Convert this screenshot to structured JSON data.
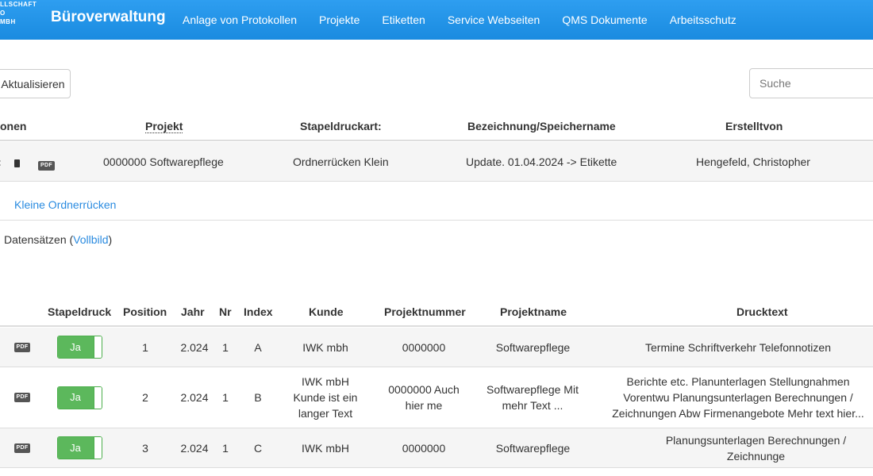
{
  "navbar": {
    "logo_lines": [
      "LLSCHAFT",
      "O",
      "MBH"
    ],
    "brand": "Büroverwaltung",
    "links": [
      "Anlage von Protokollen",
      "Projekte",
      "Etiketten",
      "Service Webseiten",
      "QMS Dokumente",
      "Arbeitsschutz"
    ]
  },
  "toolbar": {
    "refresh_label": "Aktualisieren",
    "search_placeholder": "Suche"
  },
  "top_table": {
    "headers": [
      "onen",
      "Projekt",
      "Stapeldruckart:",
      "Bezeichnung/Speichername",
      "Erstelltvon"
    ],
    "row": {
      "pdf": "PDF",
      "projekt": "0000000 Softwarepflege",
      "stapeldruckart": "Ordnerrücken Klein",
      "bezeichnung": "Update. 01.04.2024 -> Etikette",
      "erstelltvon": "Hengefeld, Christopher"
    },
    "detail_link": "Kleine Ordnerrücken"
  },
  "record_count": {
    "text": "Datensätzen (",
    "link": "Vollbild",
    "close": ")"
  },
  "bottom_table": {
    "headers": [
      "Stapeldruck",
      "Position",
      "Jahr",
      "Nr",
      "Index",
      "Kunde",
      "Projektnummer",
      "Projektname",
      "Drucktext"
    ],
    "rows": [
      {
        "pdf": "PDF",
        "toggle": "Ja",
        "position": "1",
        "jahr": "2.024",
        "nr": "1",
        "index": "A",
        "kunde": "IWK mbh",
        "projektnummer": "0000000",
        "projektname": "Softwarepflege",
        "drucktext": "Termine Schriftverkehr Telefonnotizen"
      },
      {
        "pdf": "PDF",
        "toggle": "Ja",
        "position": "2",
        "jahr": "2.024",
        "nr": "1",
        "index": "B",
        "kunde": "IWK mbH Kunde ist ein langer Text",
        "projektnummer": "0000000 Auch hier me",
        "projektname": "Softwarepflege Mit mehr Text ...",
        "drucktext": "Berichte etc. Planunterlagen Stellungnahmen Vorentwu Planungsunterlagen Berechnungen / Zeichnungen Abw Firmenangebote Mehr text hier..."
      },
      {
        "pdf": "PDF",
        "toggle": "Ja",
        "position": "3",
        "jahr": "2.024",
        "nr": "1",
        "index": "C",
        "kunde": "IWK mbH",
        "projektnummer": "0000000",
        "projektname": "Softwarepflege",
        "drucktext": "Planungsunterlagen Berechnungen / Zeichnunge"
      }
    ]
  },
  "colors": {
    "navbar": "#1a8be0",
    "link": "#2a8be0",
    "toggle_on": "#5cb85c"
  }
}
